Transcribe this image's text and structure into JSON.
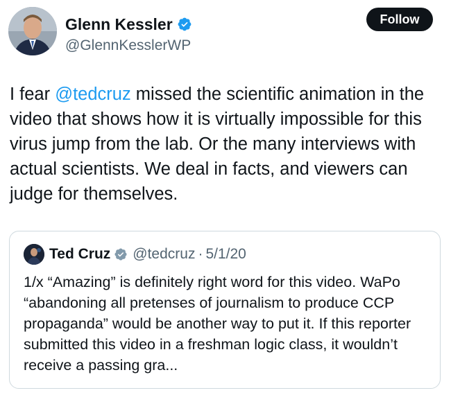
{
  "author": {
    "display_name": "Glenn Kessler",
    "handle": "@GlennKesslerWP",
    "follow_label": "Follow"
  },
  "tweet": {
    "text_before": "I fear ",
    "mention": "@tedcruz",
    "text_after": " missed the scientific animation in the video that shows how it is virtually impossible for this virus jump from the lab. Or the many interviews with actual scientists. We deal in facts, and viewers can judge for themselves."
  },
  "quoted": {
    "display_name": "Ted Cruz",
    "handle": "@tedcruz",
    "separator": "·",
    "date": "5/1/20",
    "text": "1/x “Amazing” is definitely right word for this video. WaPo “abandoning all pretenses of journalism to produce CCP propaganda” would be another way to put it. If this reporter submitted this video in a freshman logic class, it wouldn’t receive a passing gra..."
  },
  "colors": {
    "link": "#1d9bf0",
    "verified_badge": "#1d9bf0",
    "secondary_text": "#536471",
    "follow_button_bg": "#0f1419"
  },
  "icons": {
    "verified": "verified-badge-icon"
  }
}
